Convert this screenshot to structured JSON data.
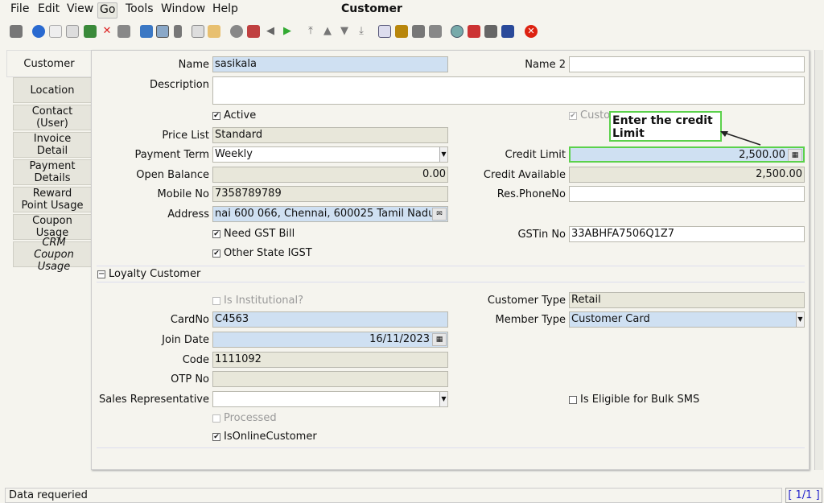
{
  "menu": {
    "file": "File",
    "edit": "Edit",
    "view": "View",
    "go": "Go",
    "tools": "Tools",
    "window": "Window",
    "help": "Help"
  },
  "window_title": "Customer",
  "toolbar_icons": [
    "undo-icon",
    "help-icon",
    "new-icon",
    "copy-icon",
    "save-icon",
    "delete-icon",
    "print-preview-icon",
    "refresh-icon",
    "find-icon",
    "attachment-icon",
    "history-icon",
    "chat-icon",
    "archive-icon",
    "home-icon",
    "back-icon",
    "forward-icon",
    "first-icon",
    "previous-icon",
    "next-icon",
    "last-icon",
    "report-icon",
    "lock-icon",
    "product-icon",
    "print-icon",
    "zoom-icon",
    "workflow-icon",
    "request-icon",
    "database-icon",
    "close-icon"
  ],
  "tabs": [
    "Customer",
    "Location",
    "Contact\n(User)",
    "Invoice\nDetail",
    "Payment\nDetails",
    "Reward\nPoint Usage",
    "Coupon\nUsage",
    "CRM\nCoupon Usage"
  ],
  "form": {
    "name_label": "Name",
    "name_value": "sasikala",
    "name2_label": "Name 2",
    "name2_value": "",
    "description_label": "Description",
    "description_value": "",
    "active_label": "Active",
    "customer_label": "Custo",
    "pricelist_label": "Price List",
    "pricelist_value": "Standard",
    "paymentterm_label": "Payment Term",
    "paymentterm_value": "Weekly",
    "creditlimit_label": "Credit Limit",
    "creditlimit_value": "2,500.00",
    "openbalance_label": "Open Balance",
    "openbalance_value": "0.00",
    "creditavailable_label": "Credit Available",
    "creditavailable_value": "2,500.00",
    "mobile_label": "Mobile No",
    "mobile_value": "7358789789",
    "resphone_label": "Res.PhoneNo",
    "resphone_value": "",
    "address_label": "Address",
    "address_value": "nai 600 066, Chennai,  600025 Tamil Nadu",
    "gstbill_label": "Need GST Bill",
    "gstin_label": "GSTin No",
    "gstin_value": "33ABHFA7506Q1Z7",
    "otherstate_label": "Other State IGST"
  },
  "loyalty": {
    "section_label": "Loyalty Customer",
    "institutional_label": "Is Institutional?",
    "customertype_label": "Customer Type",
    "customertype_value": "Retail",
    "cardno_label": "CardNo",
    "cardno_value": "C4563",
    "membertype_label": "Member Type",
    "membertype_value": "Customer Card",
    "joindate_label": "Join Date",
    "joindate_value": "16/11/2023",
    "code_label": "Code",
    "code_value": "1111092",
    "otp_label": "OTP No",
    "otp_value": "",
    "salesrep_label": "Sales Representative",
    "salesrep_value": "",
    "bulksms_label": "Is Eligible for Bulk SMS",
    "processed_label": "Processed",
    "online_label": "IsOnlineCustomer"
  },
  "callout": "Enter the credit Limit",
  "status": {
    "text": "Data requeried",
    "page": "[ 1/1 ]"
  }
}
